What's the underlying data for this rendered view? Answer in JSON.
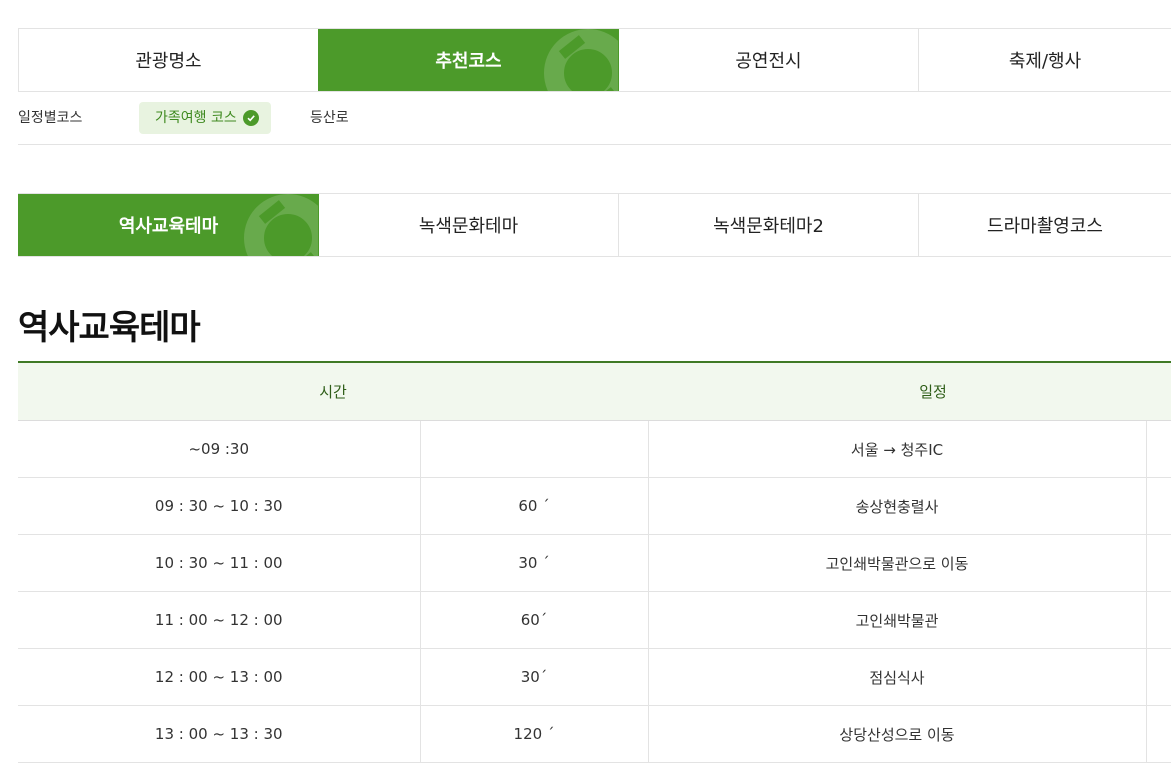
{
  "main_tabs": [
    {
      "label": "관광명소"
    },
    {
      "label": "추천코스"
    },
    {
      "label": "공연전시"
    },
    {
      "label": "축제/행사"
    }
  ],
  "sub_nav": [
    {
      "label": "일정별코스"
    },
    {
      "label": "가족여행 코스"
    },
    {
      "label": "등산로"
    }
  ],
  "theme_tabs": [
    {
      "label": "역사교육테마"
    },
    {
      "label": "녹색문화테마"
    },
    {
      "label": "녹색문화테마2"
    },
    {
      "label": "드라마촬영코스"
    }
  ],
  "page_title": "역사교육테마",
  "table": {
    "headers": {
      "time": "시간",
      "schedule": "일정"
    },
    "rows": [
      {
        "time": "~09 :30",
        "duration": "",
        "place": "서울 → 청주IC"
      },
      {
        "time": "09 : 30 ~ 10 : 30",
        "duration": "60 ´",
        "place": "송상현충렬사"
      },
      {
        "time": "10 : 30 ~ 11 : 00",
        "duration": "30 ´",
        "place": "고인쇄박물관으로 이동"
      },
      {
        "time": "11 : 00 ~ 12 : 00",
        "duration": "60´",
        "place": "고인쇄박물관"
      },
      {
        "time": "12 : 00 ~ 13 : 00",
        "duration": "30´",
        "place": "점심식사"
      },
      {
        "time": "13 : 00 ~ 13 : 30",
        "duration": "120 ´",
        "place": "상당산성으로 이동"
      }
    ]
  },
  "colors": {
    "accent": "#4c9a2a",
    "header_bg": "#f2f8ee",
    "chip_bg": "#e8f3e0"
  },
  "icons": {
    "decoration": "leaf-swirl-icon",
    "selected": "check-circle-icon"
  }
}
